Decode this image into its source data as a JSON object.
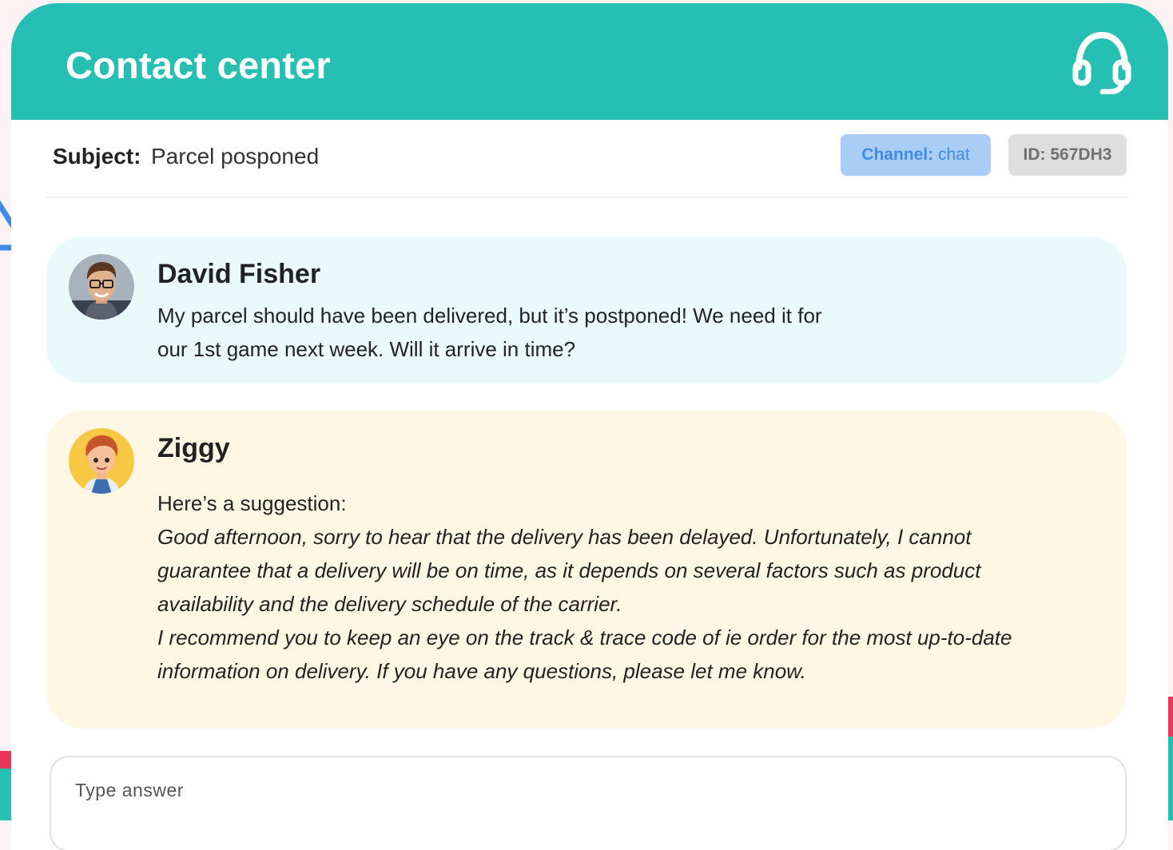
{
  "header": {
    "title": "Contact center",
    "icon": "headset-icon",
    "color": "#26bfb4"
  },
  "ticket": {
    "subject_label": "Subject:",
    "subject_value": "Parcel posponed",
    "channel_label": "Channel:",
    "channel_value": "chat",
    "id_label": "ID: 567DH3"
  },
  "messages": [
    {
      "sender": "David Fisher",
      "text": "My parcel should have been delivered, but it’s postponed! We need it for our 1st game next week. Will it arrive in time?",
      "bubble_color": "#eafafa"
    },
    {
      "sender": "Ziggy",
      "intro": "Here’s a suggestion:",
      "suggestion_paragraphs": [
        "Good afternoon, sorry to hear that the delivery has been delayed. Unfortunately, I cannot guarantee that a delivery will be on time, as it depends on several factors such as product availability and the delivery schedule of the carrier.",
        "I recommend you to keep an eye on the track & trace code of ie order for the most up-to-date information on delivery. If you have any questions, please let me know."
      ],
      "bubble_color": "#fff6e3"
    }
  ],
  "composer": {
    "placeholder": "Type answer"
  }
}
